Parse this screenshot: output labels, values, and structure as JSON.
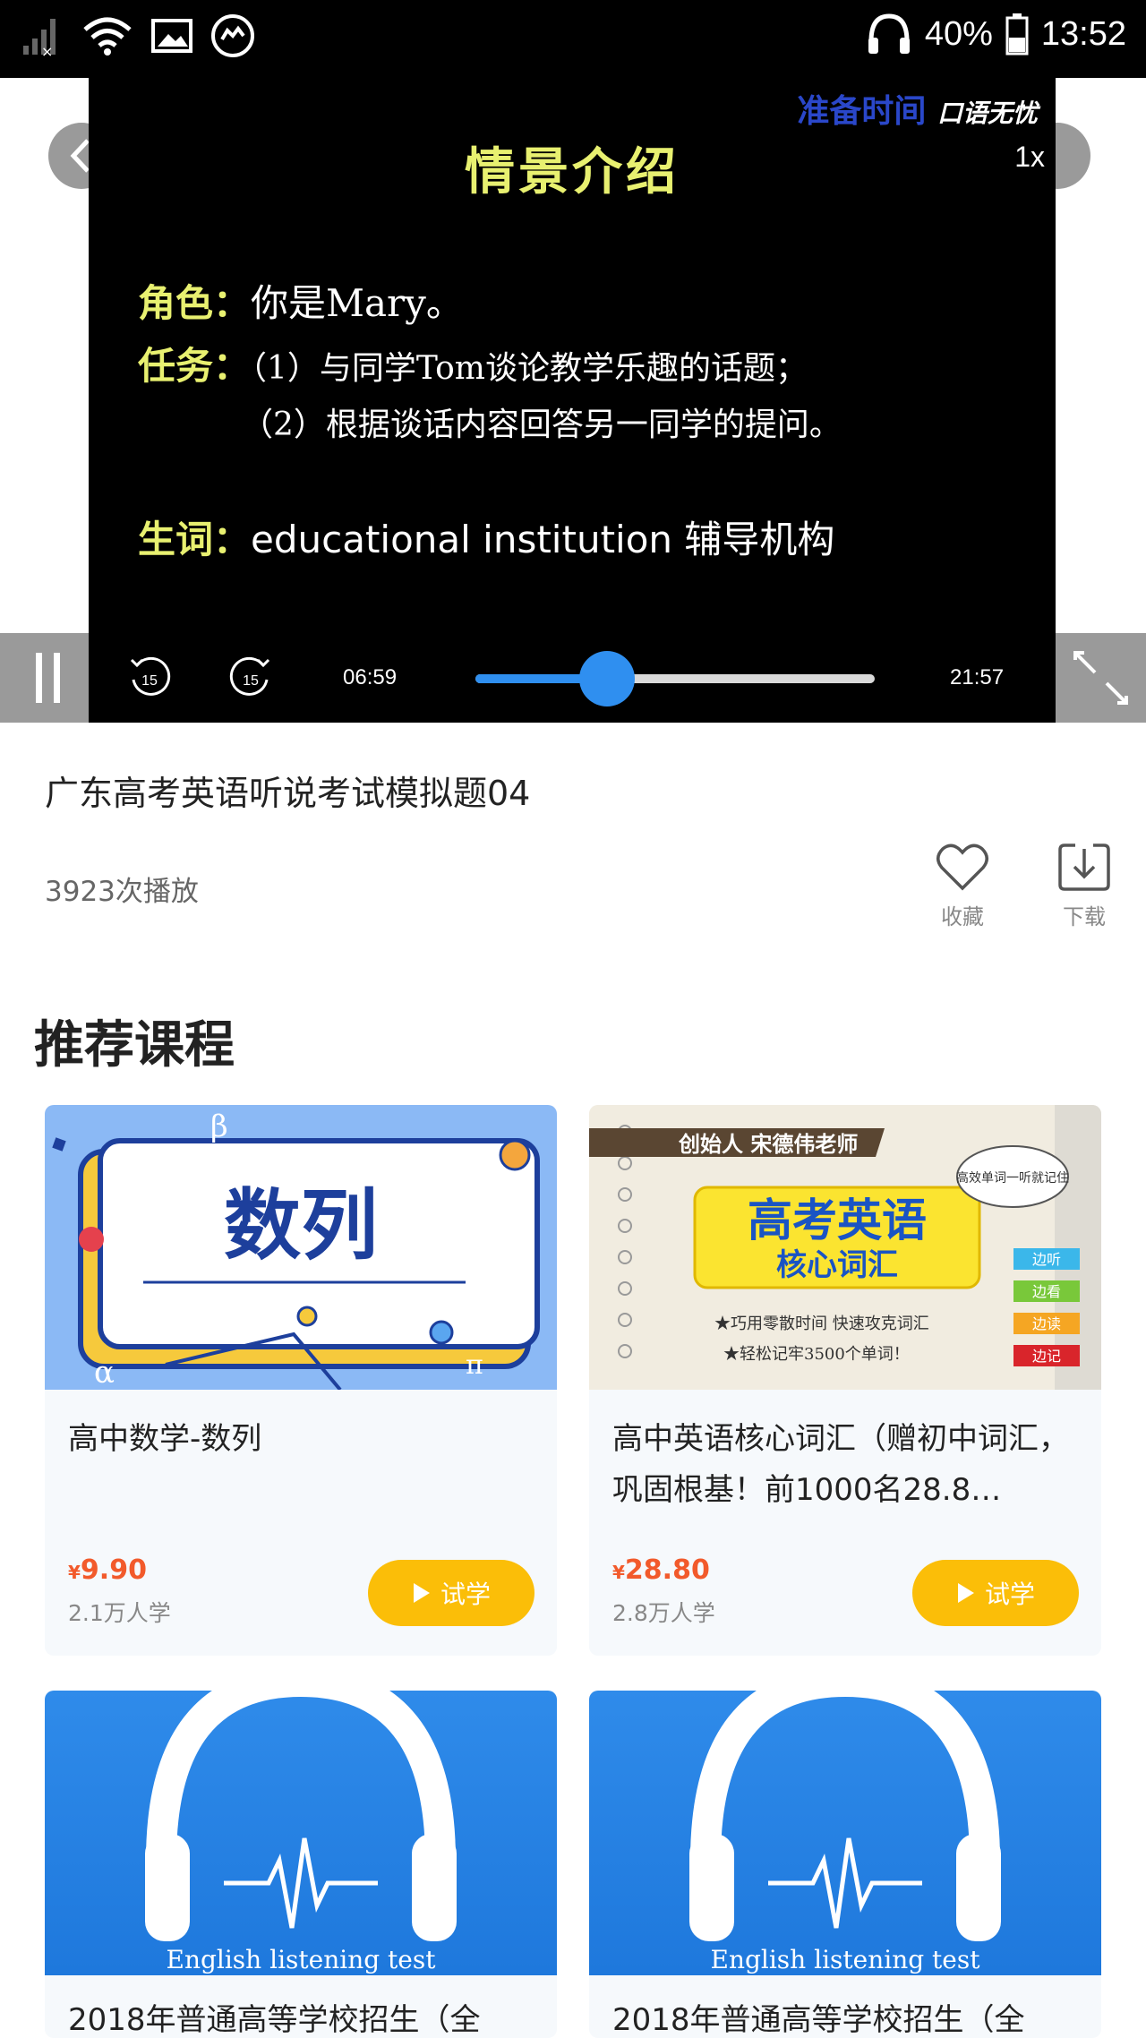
{
  "status_bar": {
    "battery": "40%",
    "time": "13:52"
  },
  "video": {
    "slide": {
      "title": "情景介绍",
      "role_label": "角色：",
      "role_text": "你是Mary。",
      "task_label": "任务：",
      "task_line1": "（1）与同学Tom谈论教学乐趣的话题；",
      "task_line2": "（2）根据谈话内容回答另一同学的提问。",
      "vocab_label": "生词：",
      "vocab_text": "educational institution  辅导机构",
      "corner_text": "准备时间",
      "logo": "口语无忧"
    },
    "speed": "1x",
    "current_time": "06:59",
    "total_time": "21:57",
    "progress": 0.33,
    "rewind_seconds": "15",
    "forward_seconds": "15"
  },
  "lesson": {
    "title": "广东高考英语听说考试模拟题04",
    "plays": "3923次播放",
    "favorite_label": "收藏",
    "download_label": "下载"
  },
  "recommend": {
    "section_title": "推荐课程",
    "courses": [
      {
        "title": "高中数学-数列",
        "cover_text": "数列",
        "currency": "¥",
        "price": "9.90",
        "learners": "2.1万人学",
        "try_label": "试学"
      },
      {
        "title": "高中英语核心词汇（赠初中词汇，巩固根基！前1000名28.8…",
        "cover_banner": "创始人 宋德伟老师",
        "cover_title": "高考英语",
        "cover_subtitle": "核心词汇",
        "cover_bubble": "高效单词一听就记住",
        "cover_line1": "★巧用零散时间 快速攻克词汇",
        "cover_line2": "★轻松记牢3500个单词！",
        "cover_tags": [
          "边听",
          "边看",
          "边读",
          "边记"
        ],
        "currency": "¥",
        "price": "28.80",
        "learners": "2.8万人学",
        "try_label": "试学"
      },
      {
        "title": "2018年普通高等学校招生（全",
        "cover_text": "English listening test"
      },
      {
        "title": "2018年普通高等学校招生（全",
        "cover_text": "English listening test"
      }
    ]
  },
  "colors": {
    "accent": "#2f8ff0",
    "price": "#f25a2b",
    "button": "#fbbe08"
  }
}
